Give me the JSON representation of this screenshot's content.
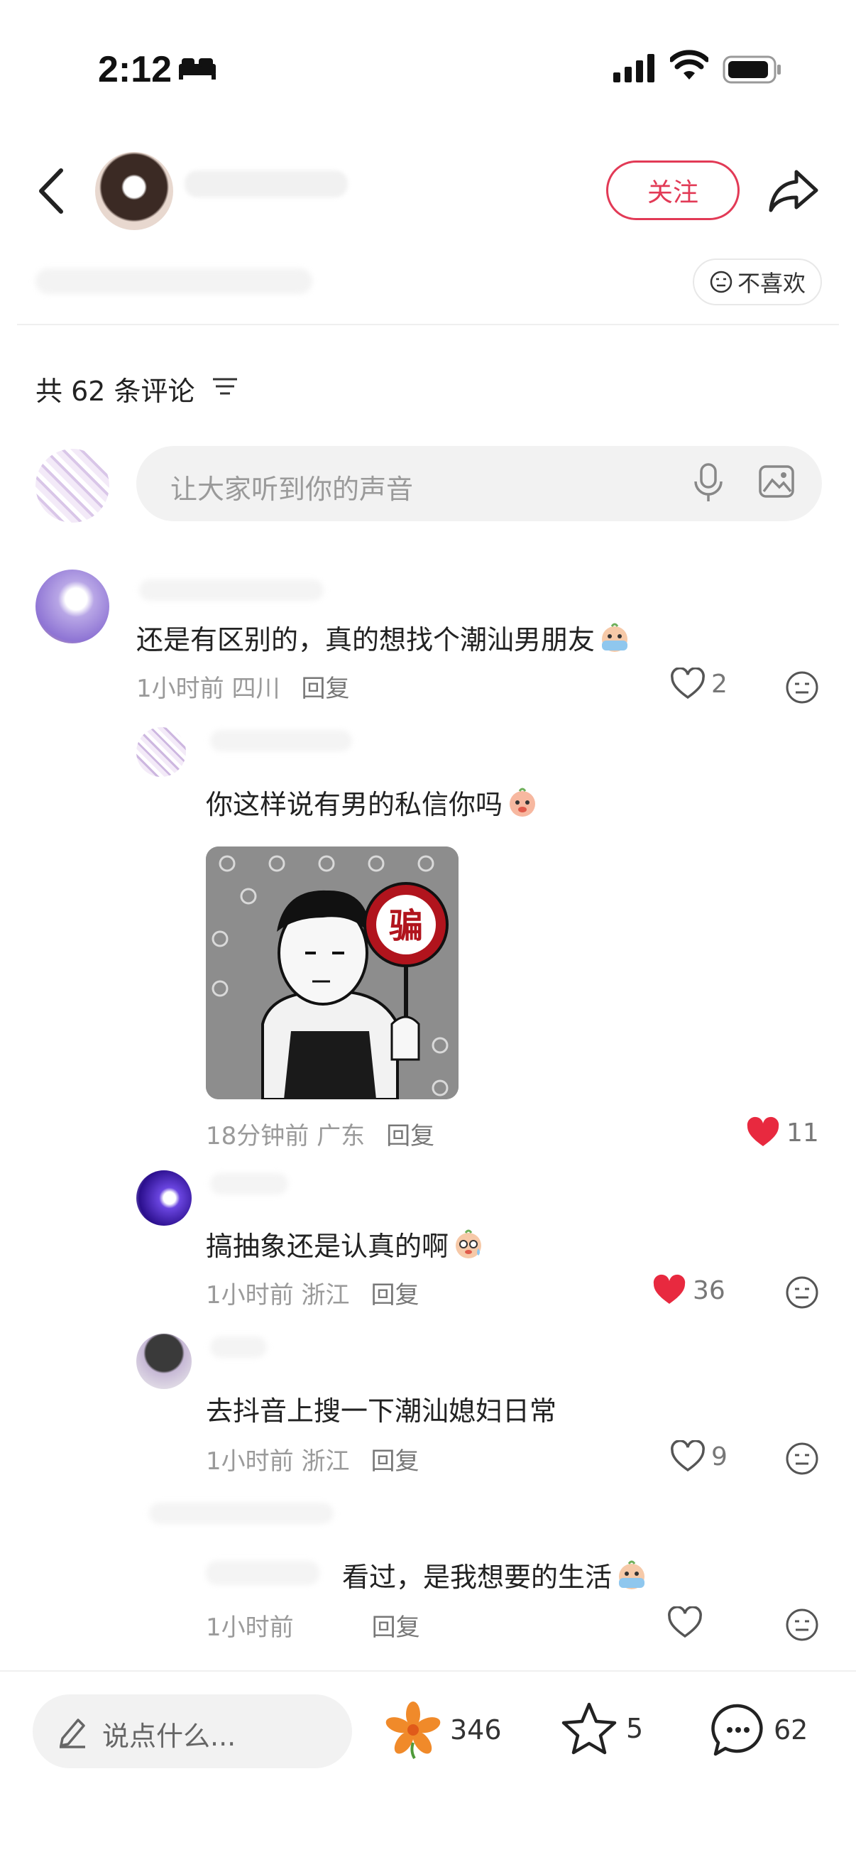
{
  "status_bar": {
    "time": "2:12"
  },
  "header": {
    "follow_label": "关注"
  },
  "actions": {
    "dislike_label": "不喜欢"
  },
  "comments_header": {
    "count_text": "共 62 条评论"
  },
  "comment_input": {
    "placeholder": "让大家听到你的声音"
  },
  "comments": [
    {
      "text": "还是有区别的，真的想找个潮汕男朋友",
      "time_location": "1小时前 四川",
      "reply_label": "回复",
      "likes": "2"
    },
    {
      "text": "你这样说有男的私信你吗",
      "time_location": "18分钟前 广东",
      "reply_label": "回复",
      "likes": "11",
      "sticker_text": "骗"
    },
    {
      "text": "搞抽象还是认真的啊",
      "time_location": "1小时前 浙江",
      "reply_label": "回复",
      "likes": "36"
    },
    {
      "text": "去抖音上搜一下潮汕媳妇日常",
      "time_location": "1小时前 浙江",
      "reply_label": "回复",
      "likes": "9"
    },
    {
      "text": "看过，是我想要的生活",
      "time_location": "1小时前",
      "reply_label": "回复",
      "likes": ""
    }
  ],
  "bottom_bar": {
    "say_placeholder": "说点什么...",
    "flowers": "346",
    "stars": "5",
    "comments": "62"
  },
  "colors": {
    "accent": "#e23a56",
    "heart_red": "#e8293f"
  },
  "icons": [
    "back-icon",
    "share-icon",
    "dislike-face-icon",
    "filter-icon",
    "mic-icon",
    "image-icon",
    "heart-icon",
    "meh-face-icon",
    "pencil-icon",
    "flower-icon",
    "star-icon",
    "chat-icon"
  ]
}
